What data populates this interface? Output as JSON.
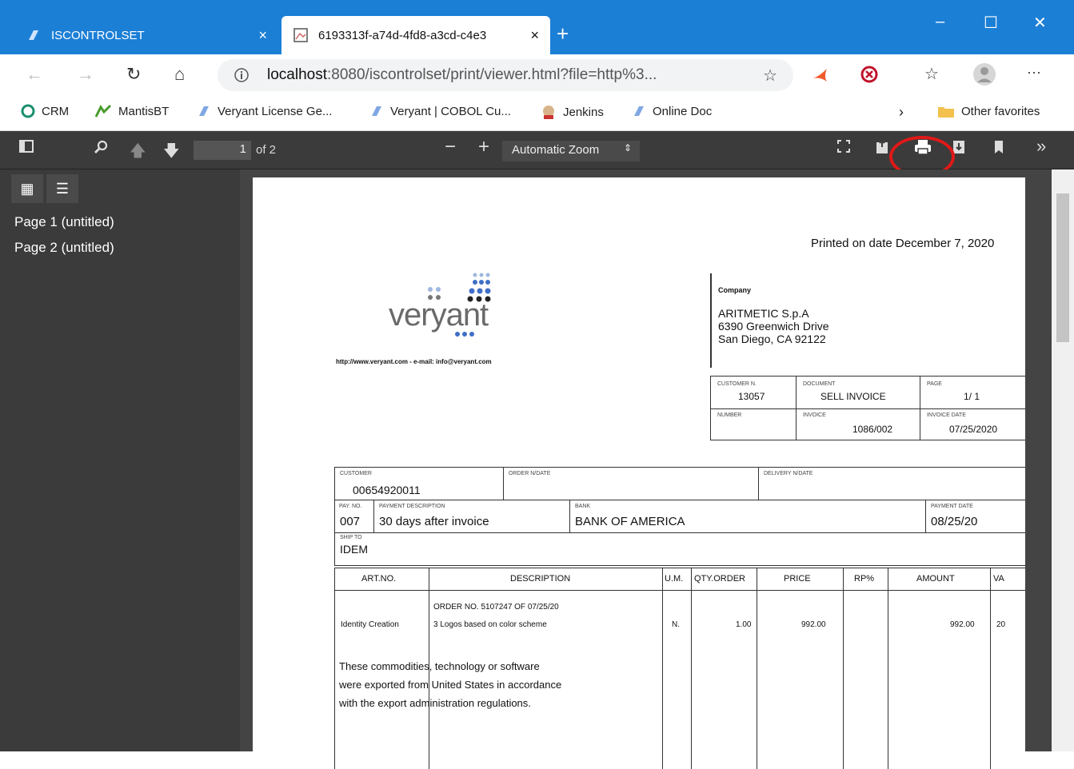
{
  "browser": {
    "tabs": [
      {
        "label": "ISCONTROLSET",
        "close": "×"
      },
      {
        "label": "6193313f-a74d-4fd8-a3cd-c4e3",
        "close": "×"
      }
    ],
    "new_tab": "+",
    "window_controls": {
      "minimize": "–",
      "maximize": "☐",
      "close": "✕"
    },
    "address": {
      "host": "localhost",
      "rest": ":8080/iscontrolset/print/viewer.html?file=http%3..."
    },
    "favorites": [
      "CRM",
      "MantisBT",
      "Veryant License Ge...",
      "Veryant | COBOL Cu...",
      "Jenkins",
      "Online Doc"
    ],
    "other_favorites": "Other favorites",
    "accent": "#1c7fd6"
  },
  "pdf": {
    "page_number": "1",
    "page_count": "of 2",
    "zoom": "Automatic Zoom",
    "sidebar_items": [
      "Page 1 (untitled)",
      "Page 2 (untitled)"
    ],
    "highlight_color": "#e01818"
  },
  "invoice": {
    "printed_on": "Printed on date December 7, 2020",
    "logo_text": "veryant",
    "contact": "http://www.veryant.com - e-mail: info@veryant.com",
    "company_label": "Company",
    "company_lines": [
      "ARITMETIC  S.p.A",
      "6390 Greenwich Drive",
      "San Diego, CA 92122"
    ],
    "header_labels": {
      "customer_n": "CUSTOMER N.",
      "document": "DOCUMENT",
      "page": "PAGE",
      "number": "NUMBER",
      "invoice": "INVOICE",
      "invoice_date": "INVOICE DATE"
    },
    "header_values": {
      "customer_n": "13057",
      "document": "SELL INVOICE",
      "page": "1/ 1",
      "invoice": "1086/002",
      "invoice_date": "07/25/2020"
    },
    "order_labels": {
      "customer": "CUSTOMER",
      "order_date": "ORDER N/DATE",
      "delivery_date": "DELIVERY N/DATE",
      "pay": "PAY. NO.",
      "payment_desc": "PAYMENT DESCRIPTION",
      "bank": "BANK",
      "payment_date": "PAYMENT DATE",
      "ship": "SHIP TO"
    },
    "order_values": {
      "customer": "00654920011",
      "pay": "007",
      "payment_desc": "30 days after invoice",
      "bank": "BANK OF AMERICA",
      "payment_date": "08/25/20",
      "ship": "IDEM"
    },
    "columns": [
      "ART.NO.",
      "DESCRIPTION",
      "U.M.",
      "QTY.ORDER",
      "PRICE",
      "RP%",
      "AMOUNT",
      "VA"
    ],
    "line_order": "ORDER NO. 5107247 OF 07/25/20",
    "line": {
      "art": "Identity Creation",
      "desc": "3 Logos based on color scheme",
      "um": "N.",
      "qty": "1.00",
      "price": "992.00",
      "amount": "992.00",
      "va": "20"
    },
    "note": [
      "These commodities, technology or software",
      "were exported from United States in accordance",
      "with the export administration regulations."
    ]
  }
}
